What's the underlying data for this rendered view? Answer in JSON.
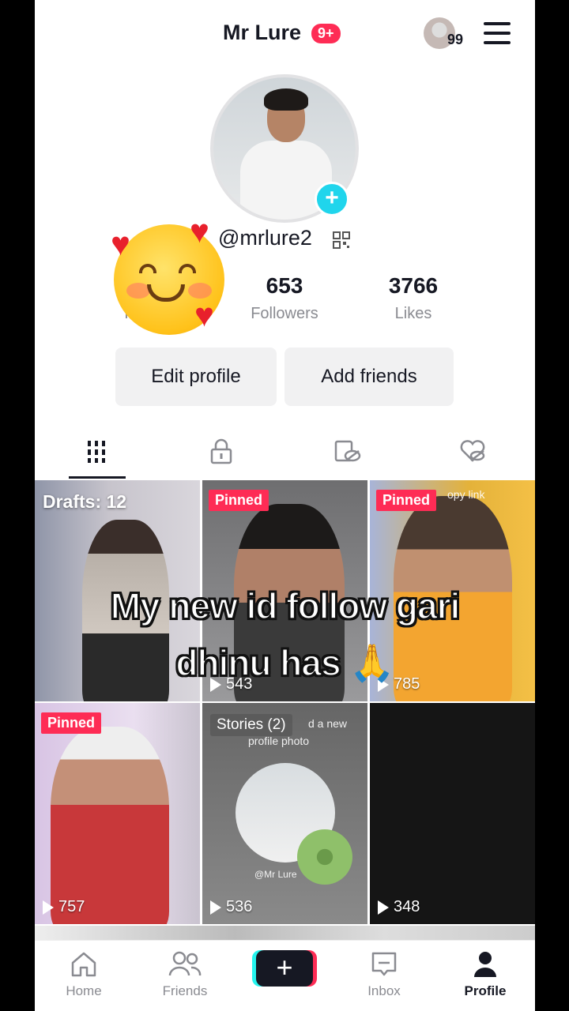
{
  "header": {
    "title": "Mr Lure",
    "notification_badge": "9+",
    "friends_count": "99"
  },
  "profile": {
    "username": "@mrlure2",
    "stats": {
      "following_label_partial": "Fo",
      "followers_value": "653",
      "followers_label": "Followers",
      "likes_value": "3766",
      "likes_label": "Likes"
    },
    "edit_button": "Edit profile",
    "add_friends_button": "Add friends"
  },
  "tabs": [
    "videos-grid",
    "private",
    "reposts",
    "liked"
  ],
  "videos": {
    "drafts_label": "Drafts: 12",
    "pinned_label": "Pinned",
    "cells": [
      {
        "views": "543"
      },
      {
        "views": "785",
        "corner_text": "opy link"
      },
      {
        "views": "757"
      },
      {
        "views": "536",
        "stories_label": "Stories (2)",
        "story_text": "d a new",
        "story_text2": "profile photo",
        "watermark": "@Mr Lure"
      },
      {
        "views": "348"
      }
    ]
  },
  "caption": {
    "line1": "My new id follow gari",
    "line2": "dhinu has",
    "emoji": "🙏"
  },
  "nav": {
    "home": "Home",
    "friends": "Friends",
    "inbox": "Inbox",
    "profile": "Profile"
  },
  "colors": {
    "accent_red": "#fe2c55",
    "accent_cyan": "#20d5ec",
    "text_primary": "#161823",
    "text_secondary": "#8a8b91"
  }
}
